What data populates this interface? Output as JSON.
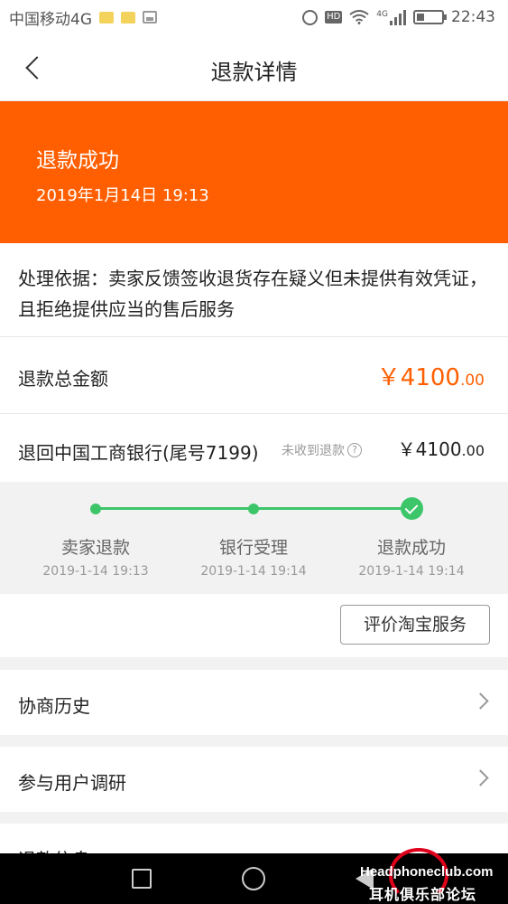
{
  "status_bar": {
    "carrier": "中国移动4G",
    "network": "4G",
    "time": "22:43"
  },
  "nav": {
    "title": "退款详情"
  },
  "banner": {
    "title": "退款成功",
    "time": "2019年1月14日 19:13"
  },
  "reason": {
    "text": "处理依据：卖家反馈签收退货存在疑义但未提供有效凭证，且拒绝提供应当的售后服务"
  },
  "total": {
    "label": "退款总金额",
    "amount_main": "￥4100",
    "amount_decimal": ".00"
  },
  "bank": {
    "label": "退回中国工商银行(尾号7199)",
    "hint": "未收到退款",
    "help_symbol": "?",
    "amount_main": "￥4100",
    "amount_decimal": ".00"
  },
  "progress": {
    "steps": [
      {
        "label": "卖家退款",
        "time": "2019-1-14 19:13"
      },
      {
        "label": "银行受理",
        "time": "2019-1-14 19:14"
      },
      {
        "label": "退款成功",
        "time": "2019-1-14 19:14"
      }
    ],
    "color": "#3cc569"
  },
  "evaluate": {
    "button_label": "评价淘宝服务"
  },
  "menu": {
    "items": [
      {
        "label": "协商历史"
      },
      {
        "label": "参与用户调研"
      },
      {
        "label": "退款信息"
      }
    ]
  },
  "watermark": {
    "top": "Headphoneclub.com",
    "bottom": "耳机俱乐部论坛"
  },
  "colors": {
    "accent": "#ff5f00",
    "success": "#3cc569"
  }
}
